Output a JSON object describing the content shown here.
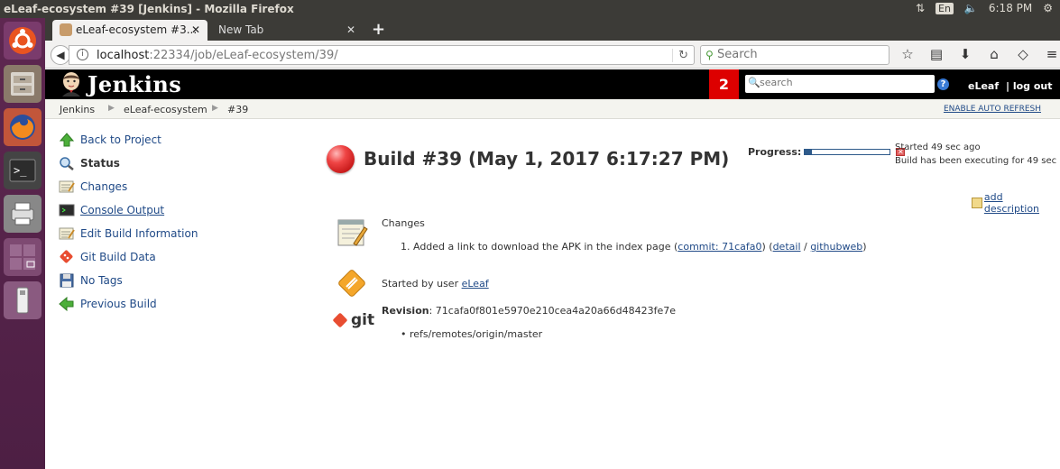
{
  "system": {
    "window_title": "eLeaf-ecosystem #39 [Jenkins] - Mozilla Firefox",
    "keyboard": "En",
    "clock": "6:18 PM"
  },
  "browser": {
    "tabs": [
      {
        "label": "eLeaf-ecosystem #3...",
        "active": true
      },
      {
        "label": "New Tab",
        "active": false
      }
    ],
    "url_host": "localhost",
    "url_rest": ":22334/job/eLeaf-ecosystem/39/",
    "search_placeholder": "Search"
  },
  "jenkins": {
    "logo_text": "Jenkins",
    "notification_count": "2",
    "search_placeholder": "search",
    "user": "eLeaf",
    "logout": "| log out",
    "help": "?"
  },
  "breadcrumb": {
    "items": [
      "Jenkins",
      "eLeaf-ecosystem",
      "#39"
    ],
    "auto_refresh": "ENABLE AUTO REFRESH"
  },
  "sidepanel": {
    "tasks": [
      {
        "label": "Back to Project",
        "icon": "up-arrow-icon"
      },
      {
        "label": "Status",
        "icon": "magnifier-icon"
      },
      {
        "label": "Changes",
        "icon": "notepad-icon"
      },
      {
        "label": "Console Output",
        "icon": "terminal-icon"
      },
      {
        "label": "Edit Build Information",
        "icon": "notepad-icon"
      },
      {
        "label": "Git Build Data",
        "icon": "git-icon"
      },
      {
        "label": "No Tags",
        "icon": "save-icon"
      },
      {
        "label": "Previous Build",
        "icon": "left-arrow-icon"
      }
    ]
  },
  "build": {
    "title": "Build #39 (May 1, 2017 6:17:27 PM)",
    "status_color": "#ef4545",
    "progress_label": "Progress:",
    "progress_fraction": 0.08,
    "started": "Started 49 sec ago",
    "executing": "Build has been executing for 49 sec",
    "add_description": "add description"
  },
  "summary": {
    "changes_label": "Changes",
    "change_prefix": "1. Added a link to download the APK in the index page (",
    "commit_link": "commit: 71cafa0",
    "mid1": ") (",
    "detail_link": "detail",
    "slash": " / ",
    "githubweb_link": "githubweb",
    "close": ")",
    "started_by_prefix": "Started by user ",
    "started_by_user": "eLeaf",
    "revision_label": "Revision",
    "revision_value": ": 71cafa0f801e5970e210cea4a20a66d48423fe7e",
    "ref": "refs/remotes/origin/master",
    "git_text": "git"
  }
}
